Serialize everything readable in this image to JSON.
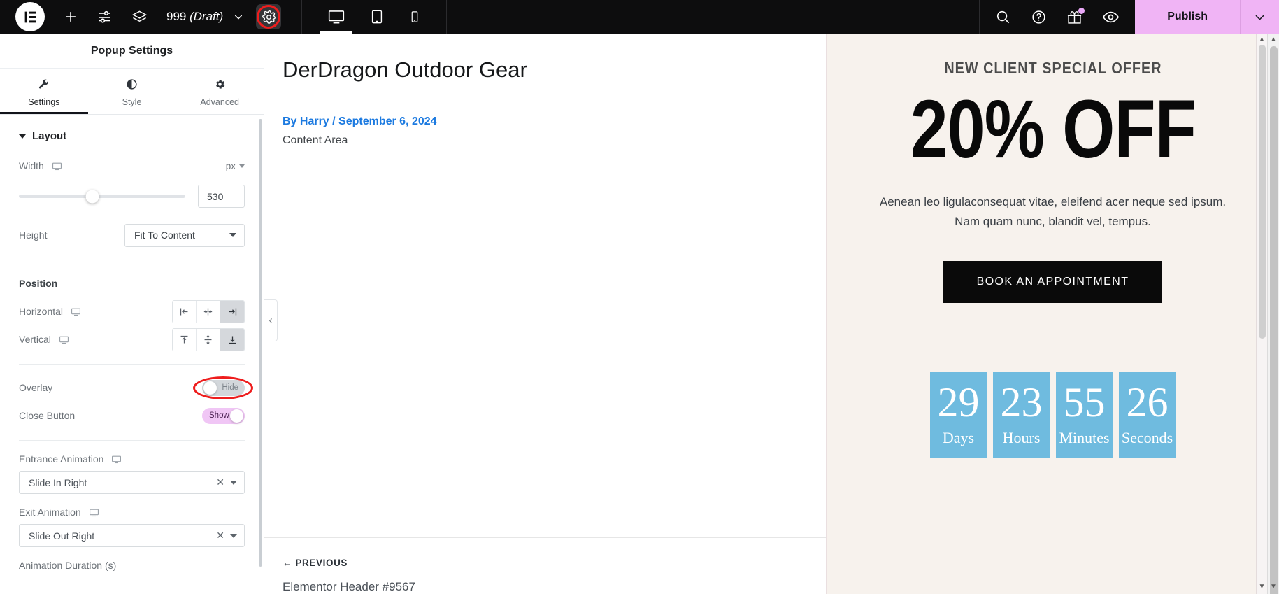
{
  "topbar": {
    "logo_icon": "elementor-logo-icon",
    "add_icon": "plus-icon",
    "settings_sliders_icon": "sliders-icon",
    "layers_icon": "layers-icon",
    "doc_number": "999",
    "doc_status": "(Draft)",
    "doc_caret_icon": "chevron-down-icon",
    "gear_icon": "gear-icon",
    "device_desktop_icon": "desktop-icon",
    "device_tablet_icon": "tablet-icon",
    "device_mobile_icon": "mobile-icon",
    "search_icon": "search-icon",
    "help_icon": "question-circle-icon",
    "gift_icon": "gift-icon",
    "preview_icon": "eye-icon",
    "publish_label": "Publish",
    "publish_caret_icon": "chevron-down-icon",
    "publish_color": "#f0b4f5"
  },
  "panel": {
    "title": "Popup Settings",
    "tabs": [
      {
        "label": "Settings",
        "icon": "wrench-icon",
        "active": true
      },
      {
        "label": "Style",
        "icon": "contrast-circle-icon",
        "active": false
      },
      {
        "label": "Advanced",
        "icon": "gear-icon",
        "active": false
      }
    ],
    "section": {
      "title": "Layout",
      "caret_icon": "caret-down-icon"
    },
    "width": {
      "label": "Width",
      "device_icon": "desktop-icon",
      "unit": "px",
      "unit_caret_icon": "chevron-down-icon",
      "value": "530"
    },
    "height": {
      "label": "Height",
      "value": "Fit To Content",
      "caret_icon": "caret-down-icon"
    },
    "position_heading": "Position",
    "horizontal": {
      "label": "Horizontal",
      "device_icon": "desktop-icon",
      "options": [
        "align-left-icon",
        "align-center-icon",
        "align-right-icon"
      ],
      "selected_index": 2
    },
    "vertical": {
      "label": "Vertical",
      "device_icon": "desktop-icon",
      "options": [
        "align-top-icon",
        "align-middle-icon",
        "align-bottom-icon"
      ],
      "selected_index": 2
    },
    "overlay": {
      "label": "Overlay",
      "state": "Hide",
      "on": false,
      "annotated": true
    },
    "close_button": {
      "label": "Close Button",
      "state": "Show",
      "on": true
    },
    "entrance_animation": {
      "label": "Entrance Animation",
      "device_icon": "desktop-icon",
      "value": "Slide In Right",
      "clear_icon": "close-icon",
      "caret_icon": "caret-down-icon"
    },
    "exit_animation": {
      "label": "Exit Animation",
      "device_icon": "desktop-icon",
      "value": "Slide Out Right",
      "clear_icon": "close-icon",
      "caret_icon": "caret-down-icon"
    },
    "animation_duration_label": "Animation Duration (s)",
    "collapse_icon": "chevron-left-icon"
  },
  "page": {
    "title": "DerDragon Outdoor Gear",
    "byline": "By Harry / September 6, 2024",
    "content_area": "Content Area",
    "prev_label": "← PREVIOUS",
    "prev_title": "Elementor Header #9567"
  },
  "popup": {
    "kicker": "NEW CLIENT SPECIAL OFFER",
    "headline": "20% OFF",
    "body": "Aenean leo ligulaconsequat vitae, eleifend acer neque sed ipsum. Nam quam nunc, blandit vel, tempus.",
    "cta_label": "BOOK AN APPOINTMENT",
    "background": "#f7f2ed",
    "countdown_color": "#6fbbdf",
    "countdown": [
      {
        "value": "29",
        "label": "Days"
      },
      {
        "value": "23",
        "label": "Hours"
      },
      {
        "value": "55",
        "label": "Minutes"
      },
      {
        "value": "26",
        "label": "Seconds"
      }
    ]
  },
  "scrollbars": {
    "up_arrow_icon": "chevron-up-icon",
    "down_arrow_icon": "chevron-down-icon"
  }
}
